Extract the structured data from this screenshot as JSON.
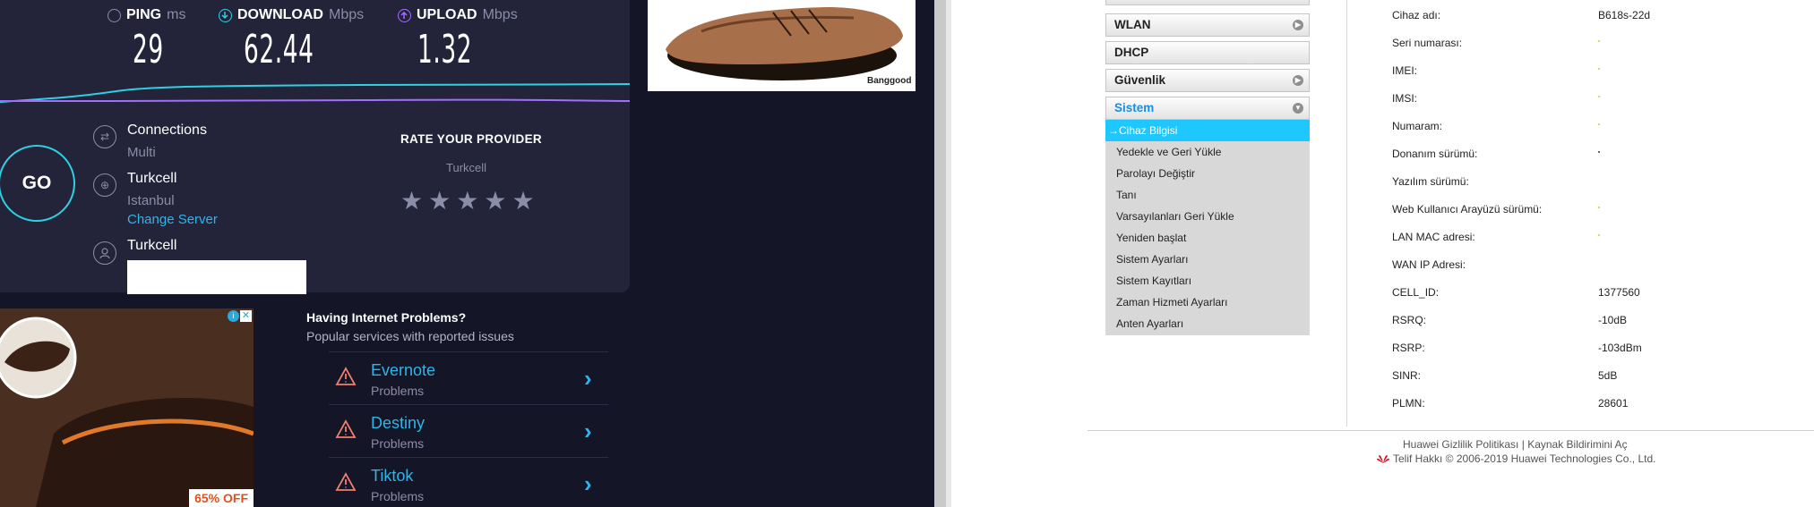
{
  "speedtest": {
    "ping": {
      "label": "PING",
      "unit": "ms",
      "value": "29"
    },
    "download": {
      "label": "DOWNLOAD",
      "unit": "Mbps",
      "value": "62.44"
    },
    "upload": {
      "label": "UPLOAD",
      "unit": "Mbps",
      "value": "1.32"
    },
    "go_label": "GO",
    "connections": {
      "label": "Connections",
      "value": "Multi"
    },
    "server": {
      "name": "Turkcell",
      "location": "Istanbul",
      "change": "Change Server"
    },
    "provider": {
      "name": "Turkcell"
    },
    "rate": {
      "title": "RATE YOUR PROVIDER",
      "provider": "Turkcell",
      "stars": 5
    },
    "shoe_ad_brand": "Banggood",
    "ad2": {
      "discount": "65% OFF"
    },
    "problems": {
      "title": "Having Internet Problems?",
      "subtitle": "Popular services with reported issues",
      "items": [
        {
          "name": "Evernote",
          "status": "Problems"
        },
        {
          "name": "Destiny",
          "status": "Problems"
        },
        {
          "name": "Tiktok",
          "status": "Problems"
        }
      ]
    },
    "colors": {
      "accent": "#2fb5e8",
      "download_line": "#2fd0e2",
      "upload_line": "#a56cff"
    }
  },
  "router": {
    "nav": [
      {
        "label": "WLAN",
        "expanded": false
      },
      {
        "label": "DHCP",
        "expanded": null
      },
      {
        "label": "Güvenlik",
        "expanded": false
      },
      {
        "label": "Sistem",
        "expanded": true
      }
    ],
    "submenu": [
      "Cihaz Bilgisi",
      "Yedekle ve Geri Yükle",
      "Parolayı Değiştir",
      "Tanı",
      "Varsayılanları Geri Yükle",
      "Yeniden başlat",
      "Sistem Ayarları",
      "Sistem Kayıtları",
      "Zaman Hizmeti Ayarları",
      "Anten Ayarları"
    ],
    "info": [
      {
        "key": "Cihaz adı:",
        "value": "B618s-22d"
      },
      {
        "key": "Seri numarası:",
        "value": ""
      },
      {
        "key": "IMEI:",
        "value": ""
      },
      {
        "key": "IMSI:",
        "value": ""
      },
      {
        "key": "Numaram:",
        "value": ""
      },
      {
        "key": "Donanım sürümü:",
        "value": ""
      },
      {
        "key": "Yazılım sürümü:",
        "value": ""
      },
      {
        "key": "Web Kullanıcı Arayüzü sürümü:",
        "value": ""
      },
      {
        "key": "LAN MAC adresi:",
        "value": ""
      },
      {
        "key": "WAN IP Adresi:",
        "value": ""
      },
      {
        "key": "CELL_ID:",
        "value": "1377560"
      },
      {
        "key": "RSRQ:",
        "value": "-10dB"
      },
      {
        "key": "RSRP:",
        "value": "-103dBm"
      },
      {
        "key": "SINR:",
        "value": "5dB"
      },
      {
        "key": "PLMN:",
        "value": "28601"
      }
    ],
    "footer": {
      "privacy": "Huawei Gizlilik Politikası",
      "separator": "|",
      "opensource": "Kaynak Bildirimini Aç",
      "copyright": "Telif Hakkı © 2006-2019 Huawei Technologies Co., Ltd."
    }
  }
}
